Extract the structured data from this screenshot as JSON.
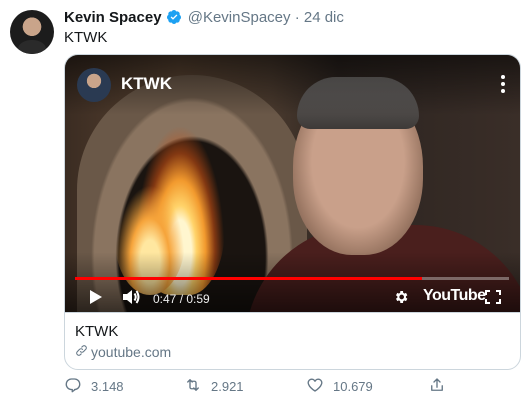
{
  "tweet": {
    "author_name": "Kevin Spacey",
    "handle": "@KevinSpacey",
    "separator": "·",
    "date": "24 dic",
    "text": "KTWK"
  },
  "video": {
    "title": "KTWK",
    "time_display": "0:47 / 0:59",
    "progress": 0.8,
    "youtube_logo_text": "YouTube"
  },
  "card": {
    "title": "KTWK",
    "domain": "youtube.com"
  },
  "actions": {
    "replies": "3.148",
    "retweets": "2.921",
    "likes": "10.679"
  },
  "colors": {
    "verified": "#1da1f2",
    "secondary_text": "#657786",
    "progress": "#ff0000"
  },
  "icons": [
    "verified-badge-icon",
    "kebab-menu-icon",
    "play-icon",
    "volume-icon",
    "gear-icon",
    "fullscreen-icon",
    "link-icon",
    "reply-icon",
    "retweet-icon",
    "like-icon",
    "share-icon"
  ]
}
